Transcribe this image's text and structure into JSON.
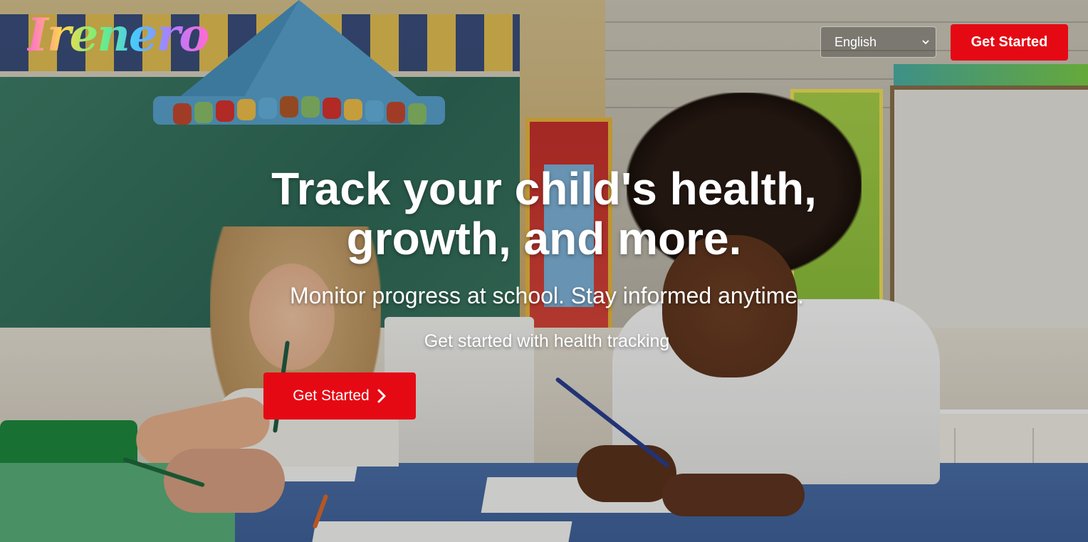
{
  "header": {
    "logo_text": "Irenero",
    "language_select": {
      "selected": "English",
      "options": [
        "English"
      ]
    },
    "get_started_label": "Get Started"
  },
  "hero": {
    "headline_line1": "Track your child's health,",
    "headline_line2": "growth, and more.",
    "subheadline": "Monitor progress at school. Stay informed anytime.",
    "cta_text": "Get started with health tracking",
    "cta_button_label": "Get Started",
    "background_image": "classroom-children-drawing"
  },
  "colors": {
    "accent": "#e50914",
    "text": "#ffffff"
  },
  "icons": {
    "language_chevron": "chevron-down-icon",
    "cta_arrow": "chevron-right-icon"
  }
}
